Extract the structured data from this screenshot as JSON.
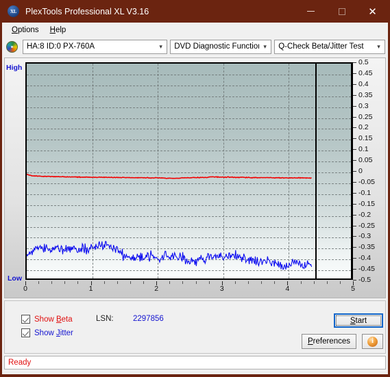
{
  "window": {
    "title": "PlexTools Professional XL V3.16",
    "app_icon": "xl-logo-icon",
    "minimize_label": "—",
    "maximize_label": "□",
    "close_label": "✕",
    "titlebar_color": "#6b2410"
  },
  "menubar": {
    "items": [
      {
        "label": "Options",
        "accel": "O"
      },
      {
        "label": "Help",
        "accel": "H"
      }
    ]
  },
  "toolbar": {
    "drive_icon": "optical-disc-icon",
    "drive_select": {
      "value": "HA:8 ID:0  PX-760A"
    },
    "function_select": {
      "value": "DVD Diagnostic Functions"
    },
    "test_select": {
      "value": "Q-Check Beta/Jitter Test"
    }
  },
  "chart_data": {
    "type": "line",
    "title": "",
    "xlabel": "",
    "ylabel": "",
    "xlim": [
      0,
      5
    ],
    "ylim": [
      -0.5,
      0.5
    ],
    "grid": true,
    "legend_position": "bottom-left-checkboxes",
    "axis_side_labels": {
      "top": "High",
      "bottom": "Low"
    },
    "ytick_labels": [
      "0.5",
      "0.45",
      "0.4",
      "0.35",
      "0.3",
      "0.25",
      "0.2",
      "0.15",
      "0.1",
      "0.05",
      "0",
      "-0.05",
      "-0.1",
      "-0.15",
      "-0.2",
      "-0.25",
      "-0.3",
      "-0.35",
      "-0.4",
      "-0.45",
      "-0.5"
    ],
    "ytick_values": [
      0.5,
      0.45,
      0.4,
      0.35,
      0.3,
      0.25,
      0.2,
      0.15,
      0.1,
      0.05,
      0,
      -0.05,
      -0.1,
      -0.15,
      -0.2,
      -0.25,
      -0.3,
      -0.35,
      -0.4,
      -0.45,
      -0.5
    ],
    "xtick_labels": [
      "0",
      "1",
      "2",
      "3",
      "4",
      "5"
    ],
    "xtick_values": [
      0,
      1,
      2,
      3,
      4,
      5
    ],
    "data_end_x": 4.4,
    "series": [
      {
        "name": "Beta",
        "color": "#f20000",
        "x": [
          0.0,
          0.05,
          0.1,
          0.2,
          0.3,
          0.45,
          0.6,
          0.8,
          1.0,
          1.2,
          1.4,
          1.6,
          1.8,
          2.0,
          2.15,
          2.3,
          2.45,
          2.6,
          2.75,
          2.85,
          3.0,
          3.2,
          3.4,
          3.6,
          3.8,
          4.0,
          4.2,
          4.4
        ],
        "values": [
          -0.015,
          -0.02,
          -0.022,
          -0.024,
          -0.025,
          -0.026,
          -0.027,
          -0.028,
          -0.029,
          -0.029,
          -0.03,
          -0.031,
          -0.031,
          -0.032,
          -0.033,
          -0.034,
          -0.031,
          -0.03,
          -0.03,
          -0.027,
          -0.028,
          -0.029,
          -0.03,
          -0.031,
          -0.031,
          -0.032,
          -0.032,
          -0.033
        ]
      },
      {
        "name": "Jitter",
        "color": "#0a0af0",
        "x": [
          0.0,
          0.1,
          0.2,
          0.3,
          0.4,
          0.5,
          0.6,
          0.7,
          0.8,
          0.9,
          1.0,
          1.1,
          1.2,
          1.3,
          1.4,
          1.5,
          1.6,
          1.7,
          1.8,
          1.9,
          2.0,
          2.1,
          2.2,
          2.3,
          2.4,
          2.5,
          2.6,
          2.7,
          2.8,
          2.9,
          3.0,
          3.1,
          3.2,
          3.3,
          3.4,
          3.5,
          3.6,
          3.7,
          3.8,
          3.9,
          4.0,
          4.1,
          4.2,
          4.3,
          4.4
        ],
        "values": [
          -0.382,
          -0.372,
          -0.362,
          -0.358,
          -0.36,
          -0.362,
          -0.36,
          -0.358,
          -0.36,
          -0.362,
          -0.358,
          -0.35,
          -0.348,
          -0.352,
          -0.36,
          -0.395,
          -0.408,
          -0.402,
          -0.4,
          -0.404,
          -0.402,
          -0.4,
          -0.398,
          -0.402,
          -0.408,
          -0.42,
          -0.425,
          -0.412,
          -0.4,
          -0.398,
          -0.402,
          -0.398,
          -0.4,
          -0.404,
          -0.408,
          -0.418,
          -0.422,
          -0.418,
          -0.425,
          -0.438,
          -0.44,
          -0.42,
          -0.428,
          -0.442,
          -0.435
        ],
        "noise_band": 0.035
      }
    ]
  },
  "controls": {
    "show_beta": {
      "label_pre": "Show ",
      "label_accel": "B",
      "label_post": "eta",
      "checked": true,
      "color": "#e01010"
    },
    "show_jitter": {
      "label_pre": "Show ",
      "label_accel": "J",
      "label_post": "itter",
      "checked": true,
      "color": "#1414d0"
    },
    "lsn_label": "LSN:",
    "lsn_value": "2297856",
    "start_button": {
      "label_pre": "",
      "label_accel": "S",
      "label_post": "tart",
      "focused": true
    },
    "preferences_button": {
      "label_pre": "",
      "label_accel": "P",
      "label_post": "references"
    },
    "info_button": {
      "icon": "info-icon",
      "glyph": "i"
    }
  },
  "statusbar": {
    "text": "Ready",
    "color": "#e01010"
  }
}
